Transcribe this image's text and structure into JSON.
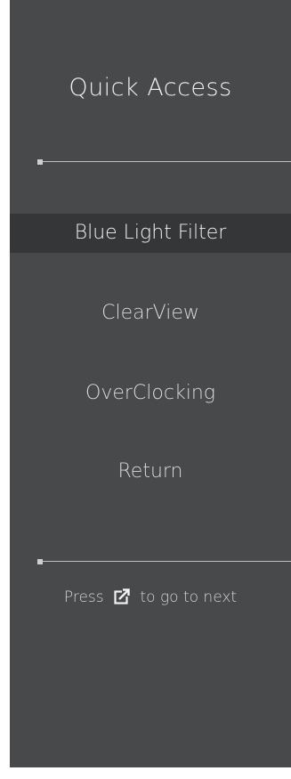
{
  "menu": {
    "title": "Quick Access",
    "items": [
      {
        "label": "Blue Light Filter",
        "selected": true
      },
      {
        "label": "ClearView",
        "selected": false
      },
      {
        "label": "OverClocking",
        "selected": false
      },
      {
        "label": "Return",
        "selected": false
      }
    ]
  },
  "hint": {
    "prefix": "Press",
    "icon": "external-link-icon",
    "suffix": "to go to next"
  },
  "colors": {
    "panel_bg": "#48494b",
    "selected_bg": "#353637",
    "text": "#d8d8d8"
  }
}
